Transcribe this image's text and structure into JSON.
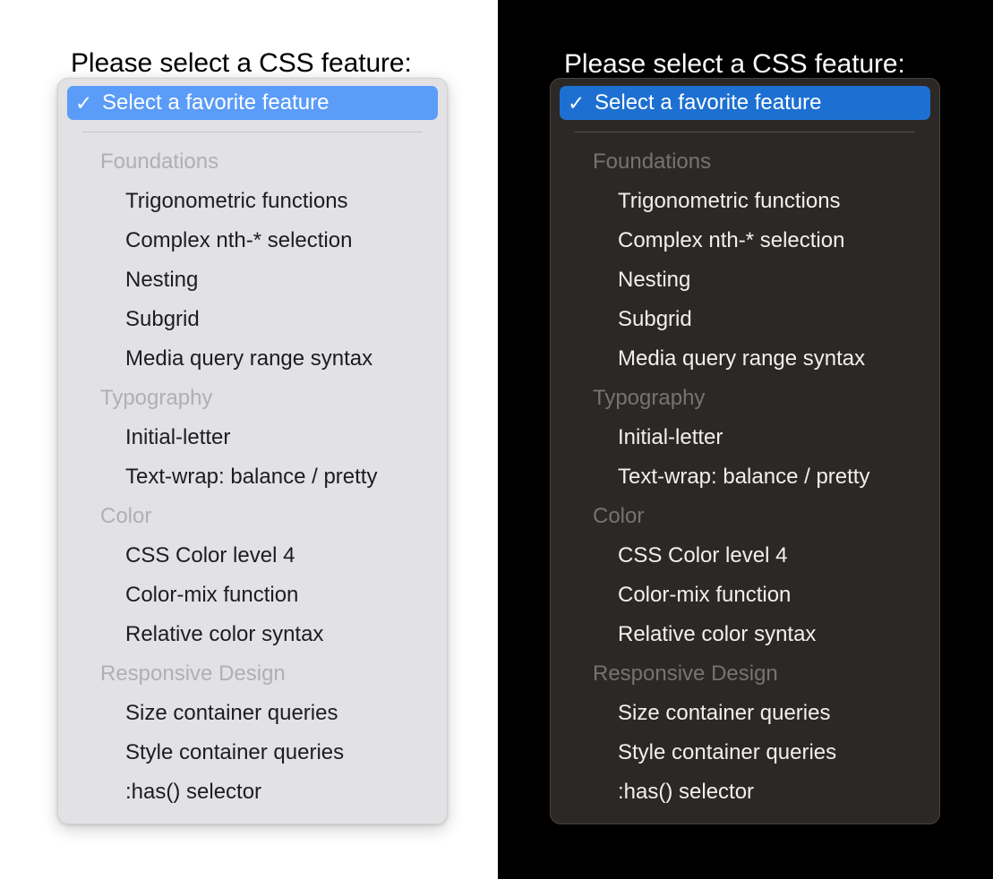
{
  "panels": [
    {
      "theme": "light",
      "title": "Please select a CSS feature:",
      "selected_option": {
        "check_icon": "checkmark-icon",
        "check_glyph": "✓",
        "label": "Select a favorite feature"
      },
      "background": "#e2e2e4",
      "highlight_color": "#5a9cf8",
      "text_color": "#1d1d1f",
      "header_color": "#b0b0b2",
      "page_background": "#ffffff",
      "title_color": "#000000"
    },
    {
      "theme": "dark",
      "title": "Please select a CSS feature:",
      "selected_option": {
        "check_icon": "checkmark-icon",
        "check_glyph": "✓",
        "label": "Select a favorite feature"
      },
      "background": "#2b2826",
      "highlight_color": "#1d6fd1",
      "text_color": "#f2f0ee",
      "header_color": "#77736f",
      "page_background": "#000000",
      "title_color": "#ffffff"
    }
  ],
  "groups": [
    {
      "label": "Foundations",
      "options": [
        "Trigonometric functions",
        "Complex nth-* selection",
        "Nesting",
        "Subgrid",
        "Media query range syntax"
      ]
    },
    {
      "label": "Typography",
      "options": [
        "Initial-letter",
        "Text-wrap: balance / pretty"
      ]
    },
    {
      "label": "Color",
      "options": [
        "CSS Color level 4",
        "Color-mix function",
        "Relative color syntax"
      ]
    },
    {
      "label": "Responsive Design",
      "options": [
        "Size container queries",
        "Style container queries",
        ":has() selector"
      ]
    }
  ]
}
